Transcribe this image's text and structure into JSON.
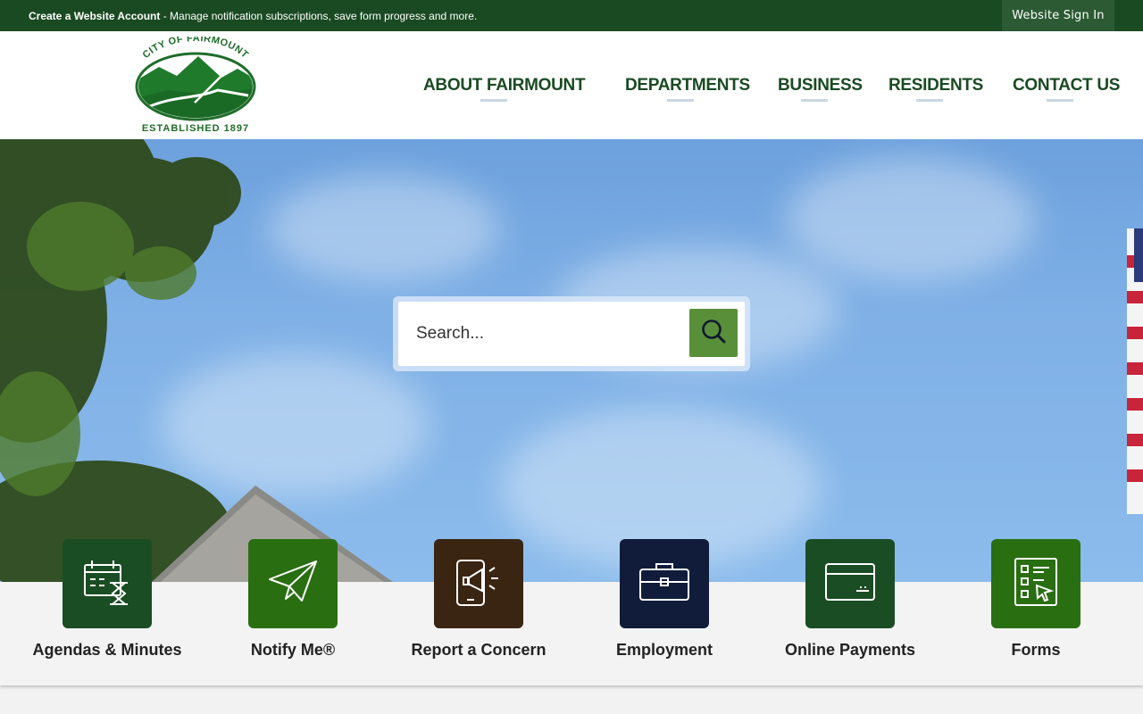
{
  "topbar": {
    "create_account_bold": "Create a Website Account",
    "create_account_rest": " - Manage notification subscriptions, save form progress and more.",
    "sign_in_label": "Website Sign In"
  },
  "logo": {
    "top_text": "CITY OF FAIRMOUNT",
    "bottom_text": "ESTABLISHED 1897",
    "icon": "city-seal-logo"
  },
  "nav": {
    "items": [
      {
        "label": "ABOUT FAIRMOUNT"
      },
      {
        "label": "DEPARTMENTS"
      },
      {
        "label": "BUSINESS"
      },
      {
        "label": "RESIDENTS"
      },
      {
        "label": "CONTACT US"
      }
    ]
  },
  "search": {
    "placeholder": "Search...",
    "icon": "search-icon"
  },
  "quick_links": [
    {
      "label": "Agendas & Minutes",
      "icon": "calendar-hourglass-icon",
      "color": "#1b4d25"
    },
    {
      "label": "Notify Me®",
      "icon": "paper-plane-icon",
      "color": "#2a6e12"
    },
    {
      "label": "Report a Concern",
      "icon": "phone-megaphone-icon",
      "color": "#3a2412"
    },
    {
      "label": "Employment",
      "icon": "briefcase-icon",
      "color": "#101c3a"
    },
    {
      "label": "Online Payments",
      "icon": "credit-card-icon",
      "color": "#1b4d25"
    },
    {
      "label": "Forms",
      "icon": "checklist-form-icon",
      "color": "#2a6e12"
    }
  ],
  "colors": {
    "brand_dark_green": "#1a4a22",
    "nav_text": "#1a4a22",
    "search_button": "#5a8f3a"
  }
}
